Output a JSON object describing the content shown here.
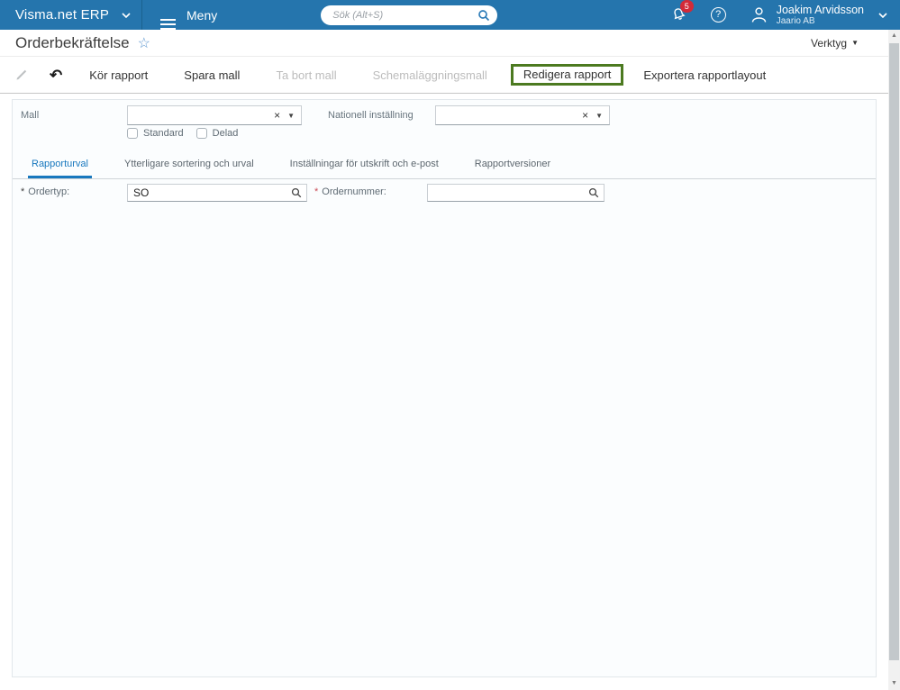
{
  "colors": {
    "header_blue": "#2575ad",
    "badge_red": "#d22b39",
    "tab_active_blue": "#1878be",
    "highlight_green": "#4c7a20"
  },
  "header": {
    "brand": "Visma.net ERP",
    "menu_label": "Meny",
    "search_placeholder": "Sök (Alt+S)",
    "notification_count": "5",
    "help_glyph": "?",
    "user_name": "Joakim Arvidsson",
    "user_company": "Jaario AB"
  },
  "title_bar": {
    "title": "Orderbekräftelse",
    "favorite_star_glyph": "☆",
    "tools_label": "Verktyg",
    "tools_caret_glyph": "▼"
  },
  "toolbar": {
    "undo_glyph": "↶",
    "run": "Kör rapport",
    "save_template": "Spara mall",
    "delete_template": "Ta bort mall",
    "schedule_template": "Schemaläggningsmall",
    "edit_report": "Redigera rapport",
    "export_layout": "Exportera rapportlayout"
  },
  "template_section": {
    "mall_label": "Mall",
    "mall_value": "",
    "standard_label": "Standard",
    "delad_label": "Delad",
    "locale_label": "Nationell inställning",
    "locale_value": "",
    "clear_glyph": "×",
    "dropdown_glyph": "▼"
  },
  "tabs": [
    {
      "label": "Rapporturval"
    },
    {
      "label": "Ytterligare sortering och urval"
    },
    {
      "label": "Inställningar för utskrift och e-post"
    },
    {
      "label": "Rapportversioner"
    }
  ],
  "fields": {
    "required_marker": "*",
    "ordertyp_label": "Ordertyp:",
    "ordertyp_value": "SO",
    "ordernummer_label": "Ordernummer:",
    "ordernummer_value": ""
  },
  "scrollbar": {
    "up_glyph": "▲",
    "down_glyph": "▼"
  }
}
